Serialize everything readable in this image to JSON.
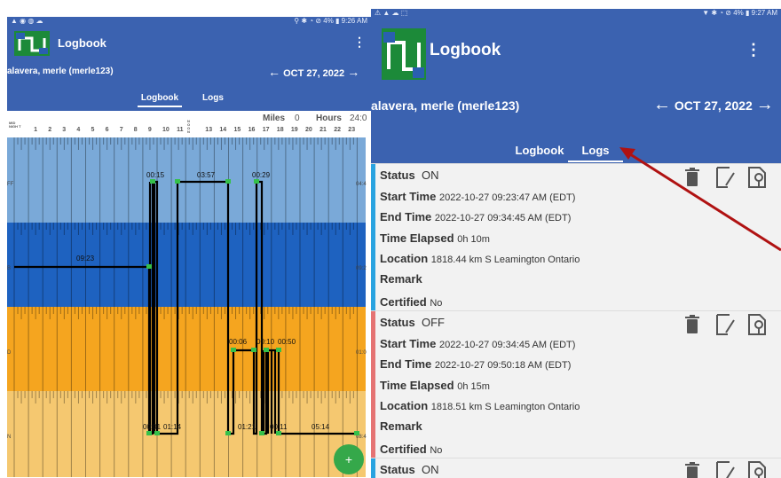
{
  "left": {
    "status": {
      "left": "▲ ◉ ◍ ☁",
      "right": "⚲ ✱ ◔ ⊘ 4% ▮ 9:26 AM"
    },
    "app_title": "Logbook",
    "menu_icon": "kebab-menu-icon",
    "driver": "alavera, merle (merle123)",
    "date": "OCT 27, 2022",
    "tabs": [
      "Logbook",
      "Logs"
    ],
    "miles_label": "Miles",
    "miles_value": "0",
    "hours_label": "Hours",
    "hours_value": "24:0",
    "midnight": "MID NIGH T",
    "noon": "NOON",
    "hours": [
      "1",
      "2",
      "3",
      "4",
      "5",
      "6",
      "7",
      "8",
      "9",
      "10",
      "11",
      "13",
      "14",
      "15",
      "16",
      "17",
      "18",
      "19",
      "20",
      "21",
      "22",
      "23"
    ],
    "row_labels": [
      "FF",
      "B",
      "D",
      "N"
    ],
    "row_totals": [
      "04:4",
      "09:2",
      "01:0",
      "08:4"
    ],
    "durations": {
      "off1": "00:15",
      "off2": "03:57",
      "off3": "00:29",
      "sb1": "09:23",
      "d1": "00:06",
      "d2": "00:10",
      "d3": "00:50",
      "on1": "00:01",
      "on2": "01:14",
      "on3": "01:21",
      "on4": "00:11",
      "on5": "05:14"
    },
    "band_colors": {
      "off": "#7aa9d8",
      "sb": "#1e62c0",
      "d": "#f5a51f",
      "on": "#f5c870"
    },
    "fab_label": "+"
  },
  "right": {
    "status": {
      "left": "⚠ ▲ ☁ ⬚",
      "right": "▼ ✱ ◔ ⊘ 4% ▮ 9:27 AM"
    },
    "app_title": "Logbook",
    "driver": "alavera, merle (merle123)",
    "date": "OCT 27, 2022",
    "tabs": [
      "Logbook",
      "Logs"
    ],
    "labels": {
      "status": "Status",
      "start": "Start Time",
      "end": "End Time",
      "elapsed": "Time Elapsed",
      "location": "Location",
      "remark": "Remark",
      "certified": "Certified"
    },
    "entries": [
      {
        "status": "ON",
        "start": "2022-10-27 09:23:47 AM (EDT)",
        "end": "2022-10-27 09:34:45 AM (EDT)",
        "elapsed": "0h 10m",
        "location": "1818.44 km S Leamington Ontario",
        "certified": "No",
        "color": "#29a3e0"
      },
      {
        "status": "OFF",
        "start": "2022-10-27 09:34:45 AM (EDT)",
        "end": "2022-10-27 09:50:18 AM (EDT)",
        "elapsed": "0h 15m",
        "location": "1818.51 km S Leamington Ontario",
        "certified": "No",
        "color": "#e57373"
      },
      {
        "status": "ON",
        "color": "#29a3e0"
      }
    ],
    "icons": [
      "trash-icon",
      "edit-icon",
      "location-pin-icon"
    ],
    "annotation_arrow_color": "#b01212"
  }
}
